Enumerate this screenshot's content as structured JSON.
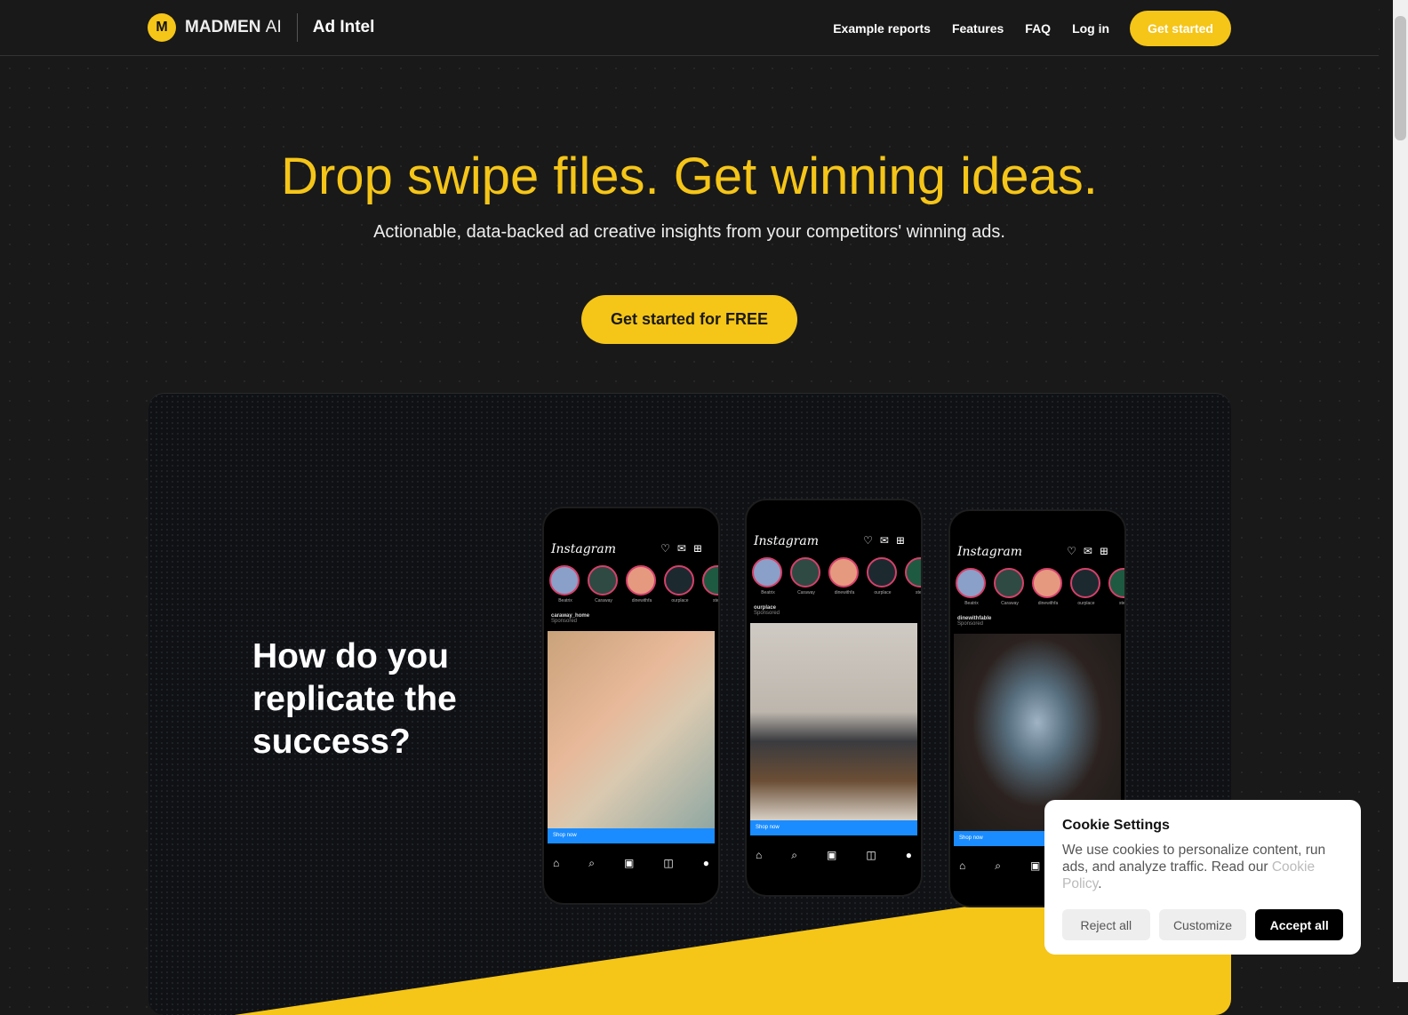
{
  "header": {
    "brand": "MADMEN",
    "brand_suffix": "AI",
    "product": "Ad Intel",
    "nav": [
      "Example reports",
      "Features",
      "FAQ",
      "Log in"
    ],
    "cta": "Get started"
  },
  "hero": {
    "title": "Drop swipe files. Get winning ideas.",
    "subtitle": "Actionable, data-backed ad creative insights from your competitors' winning ads.",
    "cta": "Get started for FREE"
  },
  "feature": {
    "question": "How do you replicate the success?",
    "phones": [
      {
        "app": "Instagram",
        "stories": [
          "Beatrix",
          "Caraway",
          "dinewithfa",
          "ourplace",
          "steve"
        ],
        "account": "caraway_home",
        "sponsored": "Sponsored",
        "cta": "Shop now"
      },
      {
        "app": "Instagram",
        "stories": [
          "Beatrix",
          "Caraway",
          "dinewithfa",
          "ourplace",
          "steve"
        ],
        "account": "ourplace",
        "sponsored": "Sponsored",
        "cta": "Shop now"
      },
      {
        "app": "Instagram",
        "stories": [
          "Beatrix",
          "Caraway",
          "dinewithfa",
          "ourplace",
          "steve"
        ],
        "account": "dinewithfable",
        "sponsored": "Sponsored",
        "cta": "Shop now"
      }
    ]
  },
  "cookie": {
    "title": "Cookie Settings",
    "text": "We use cookies to personalize content, run ads, and analyze traffic. Read our ",
    "link": "Cookie Policy",
    "after": ".",
    "reject": "Reject all",
    "customize": "Customize",
    "accept": "Accept all"
  },
  "colors": {
    "accent": "#f5c518",
    "background": "#191919"
  }
}
